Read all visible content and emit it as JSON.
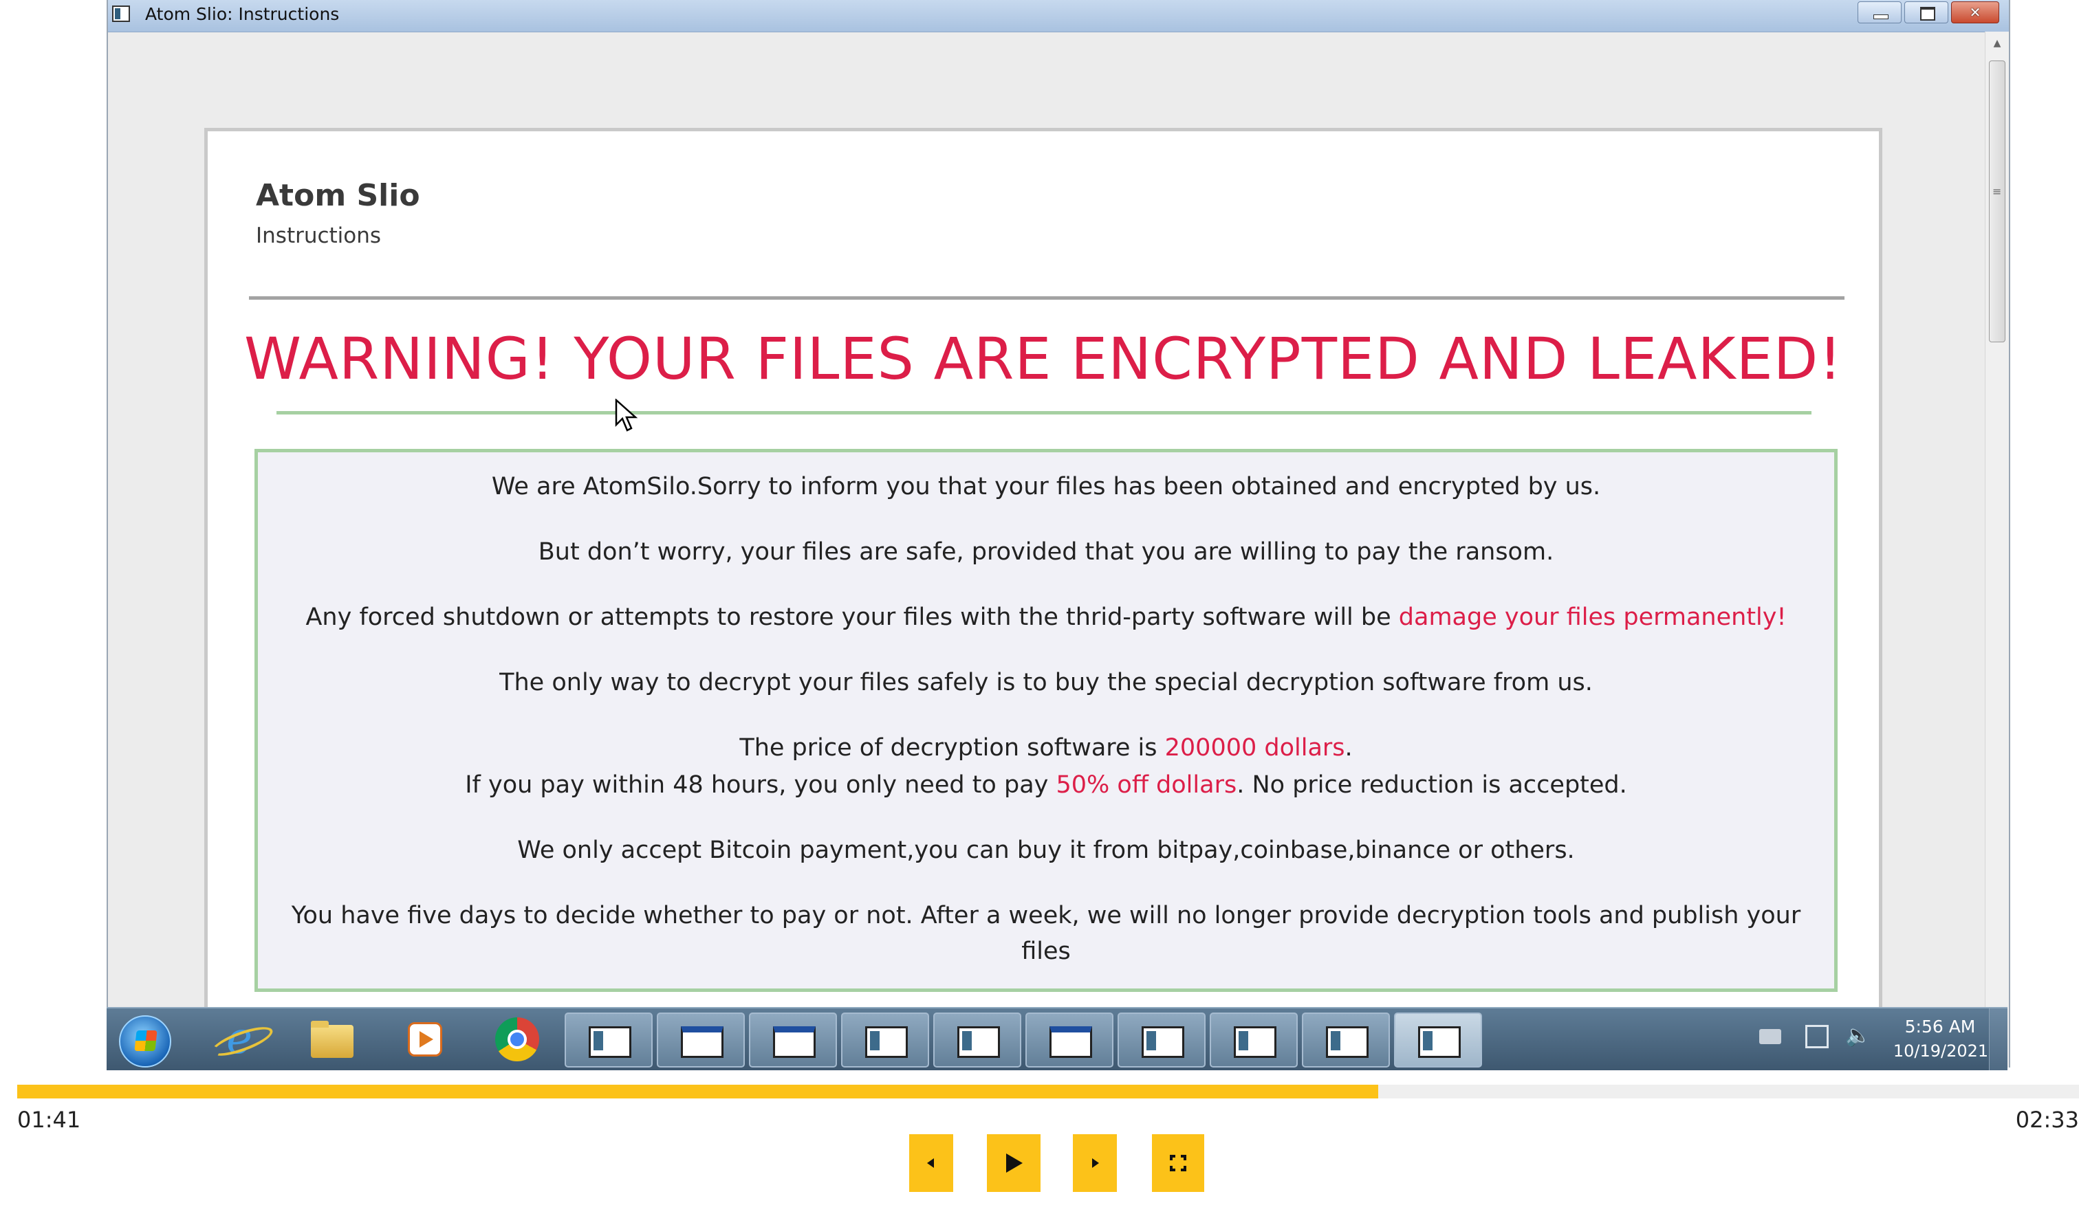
{
  "window": {
    "title": "Atom Slio: Instructions"
  },
  "note": {
    "brand": "Atom Slio",
    "subtitle": "Instructions",
    "warning": "WARNING! YOUR FILES ARE ENCRYPTED AND LEAKED!",
    "p1": "We are AtomSilo.Sorry to inform you that your files has been obtained and encrypted by us.",
    "p2": "But don’t worry, your files are safe, provided that you are willing to pay the ransom.",
    "p3_pre": "Any forced shutdown or attempts to restore your files with the thrid-party software will be ",
    "p3_red": "damage your files permanently!",
    "p4": "The only way to decrypt your files safely is to buy the special decryption software from us.",
    "p5_pre": "The price of decryption software is ",
    "p5_red": "200000 dollars",
    "p5_post": ".",
    "p6_pre": "If you pay within 48 hours, you only need to pay ",
    "p6_red": "50% off dollars",
    "p6_post": ". No price reduction is accepted.",
    "p7": "We only accept Bitcoin payment,you can buy it from bitpay,coinbase,binance or others.",
    "p8_line1": "You have five days to decide whether to pay or not. After a week, we will no longer provide decryption tools and publish your",
    "p8_line2": "files"
  },
  "taskbar": {
    "pinned": [
      "start-orb-icon",
      "internet-explorer-icon",
      "file-explorer-icon",
      "media-player-icon",
      "chrome-icon"
    ],
    "clock_time": "5:56 AM",
    "clock_date": "10/19/2021"
  },
  "player": {
    "current_time": "01:41",
    "total_time": "02:33",
    "progress": 0.66
  },
  "colors": {
    "warning_red": "#dc1e48",
    "accent_yellow": "#fcc219",
    "border_green": "#a6d0a2"
  }
}
